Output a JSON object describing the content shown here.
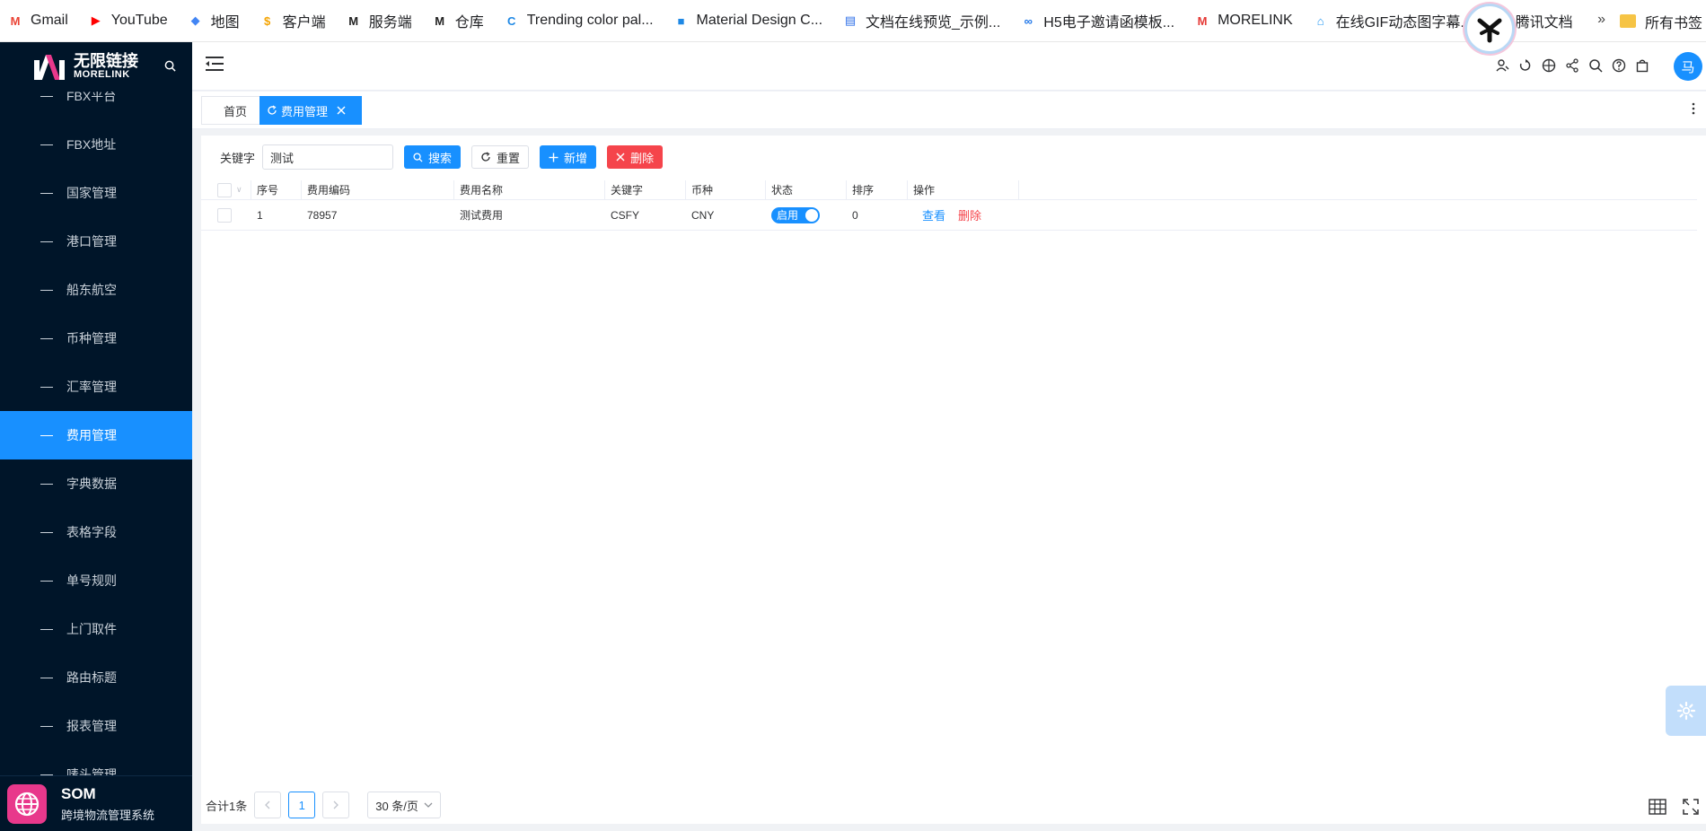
{
  "bookmarks": [
    {
      "label": "Gmail",
      "icon": "gmail-icon",
      "color": "#ea4335",
      "glyph": "M"
    },
    {
      "label": "YouTube",
      "icon": "youtube-icon",
      "color": "#ff0000",
      "glyph": "▶"
    },
    {
      "label": "地图",
      "icon": "maps-icon",
      "color": "#4285f4",
      "glyph": "◆"
    },
    {
      "label": "客户端",
      "icon": "client-icon",
      "color": "#f4a300",
      "glyph": "$"
    },
    {
      "label": "服务端",
      "icon": "morelink-icon",
      "color": "#222222",
      "glyph": "M"
    },
    {
      "label": "仓库",
      "icon": "morelink-icon",
      "color": "#222222",
      "glyph": "M"
    },
    {
      "label": "Trending color pal...",
      "icon": "coolors-icon",
      "color": "#1e88e5",
      "glyph": "C"
    },
    {
      "label": "Material Design C...",
      "icon": "material-icon",
      "color": "#1e88e5",
      "glyph": "■"
    },
    {
      "label": "文档在线预览_示例...",
      "icon": "doc-icon",
      "color": "#2b6de8",
      "glyph": "▤"
    },
    {
      "label": "H5电子邀请函模板...",
      "icon": "infinity-icon",
      "color": "#1a73e8",
      "glyph": "∞"
    },
    {
      "label": "MORELINK",
      "icon": "morelink-red-icon",
      "color": "#e53935",
      "glyph": "M"
    },
    {
      "label": "在线GIF动态图字幕...",
      "icon": "gif-icon",
      "color": "#2196f3",
      "glyph": "⌂"
    },
    {
      "label": "腾讯文档",
      "icon": "tencent-doc-icon",
      "color": "#1677ff",
      "glyph": ""
    }
  ],
  "bookmarks_more": "»",
  "bookmarks_folder": "所有书签",
  "logo": {
    "cn": "无限链接",
    "en": "MORELINK"
  },
  "menu": [
    {
      "label": "FBX平台"
    },
    {
      "label": "FBX地址"
    },
    {
      "label": "国家管理"
    },
    {
      "label": "港口管理"
    },
    {
      "label": "船东航空"
    },
    {
      "label": "币种管理"
    },
    {
      "label": "汇率管理"
    },
    {
      "label": "费用管理",
      "active": true
    },
    {
      "label": "字典数据"
    },
    {
      "label": "表格字段"
    },
    {
      "label": "单号规则"
    },
    {
      "label": "上门取件"
    },
    {
      "label": "路由标题"
    },
    {
      "label": "报表管理"
    },
    {
      "label": "唛头管理"
    }
  ],
  "footer": {
    "title": "SOM",
    "subtitle": "跨境物流管理系统"
  },
  "header": {
    "avatar": "马"
  },
  "tabs": {
    "home": "首页",
    "active": "费用管理"
  },
  "filter": {
    "label": "关键字",
    "value": "测试",
    "search": "搜索",
    "reset": "重置",
    "add": "新增",
    "delete": "删除"
  },
  "table": {
    "columns": [
      "序号",
      "费用编码",
      "费用名称",
      "关键字",
      "币种",
      "状态",
      "排序",
      "操作"
    ],
    "rows": [
      {
        "index": "1",
        "code": "78957",
        "name": "测试费用",
        "keyword": "CSFY",
        "currency": "CNY",
        "status": "启用",
        "sort": "0",
        "view": "查看",
        "delete": "删除"
      }
    ]
  },
  "pagination": {
    "total": "合计1条",
    "current": "1",
    "page_size": "30 条/页"
  },
  "colors": {
    "primary": "#1890ff",
    "danger": "#f5444b",
    "sidebar": "#001529",
    "som": "#e8388b"
  }
}
